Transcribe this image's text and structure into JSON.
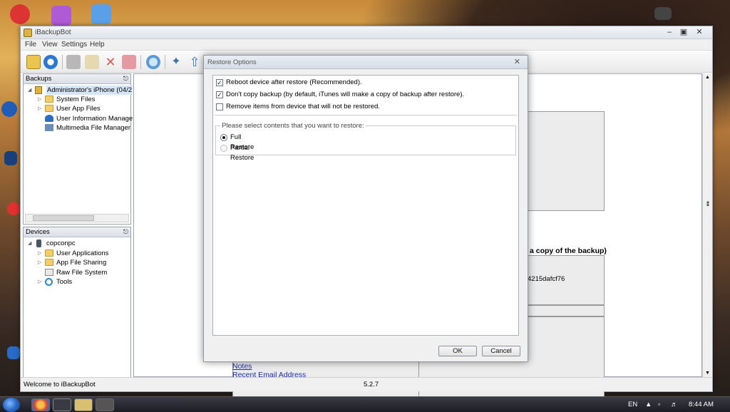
{
  "window": {
    "title": "iBackupBot",
    "menu": [
      "File",
      "View",
      "Settings",
      "Help"
    ]
  },
  "backups_panel": {
    "title": "Backups",
    "items": [
      {
        "label": "Administrator's iPhone (04/2"
      },
      {
        "label": "System Files"
      },
      {
        "label": "User App Files"
      },
      {
        "label": "User Information Manage"
      },
      {
        "label": "Multimedia File Manager"
      }
    ]
  },
  "devices_panel": {
    "title": "Devices",
    "items": [
      {
        "label": "copconpc"
      },
      {
        "label": "User Applications"
      },
      {
        "label": "App File Sharing"
      },
      {
        "label": "Raw File System"
      },
      {
        "label": "Tools"
      }
    ]
  },
  "content": {
    "heading_fragment": "a copy of the backup)",
    "id_fragment": "4215dafcf76",
    "links": [
      "Notes",
      "Recent Email Address"
    ]
  },
  "status": {
    "left": "Welcome to iBackupBot",
    "version": "5.2.7"
  },
  "dialog": {
    "title": "Restore Options",
    "options": [
      {
        "label": "Reboot device after restore (Recommended).",
        "checked": true
      },
      {
        "label": "Don't copy backup (by default, iTunes will make a copy of backup after restore).",
        "checked": true
      },
      {
        "label": "Remove items from device that will not be restored.",
        "checked": false
      }
    ],
    "group_label": "Please select contents that you want to restore:",
    "radios": [
      {
        "label": "Full Restore",
        "checked": true
      },
      {
        "label": "Partial Restore",
        "checked": false
      }
    ],
    "ok_label": "OK",
    "cancel_label": "Cancel"
  },
  "taskbar": {
    "lang": "EN",
    "time": "8:44 AM"
  }
}
